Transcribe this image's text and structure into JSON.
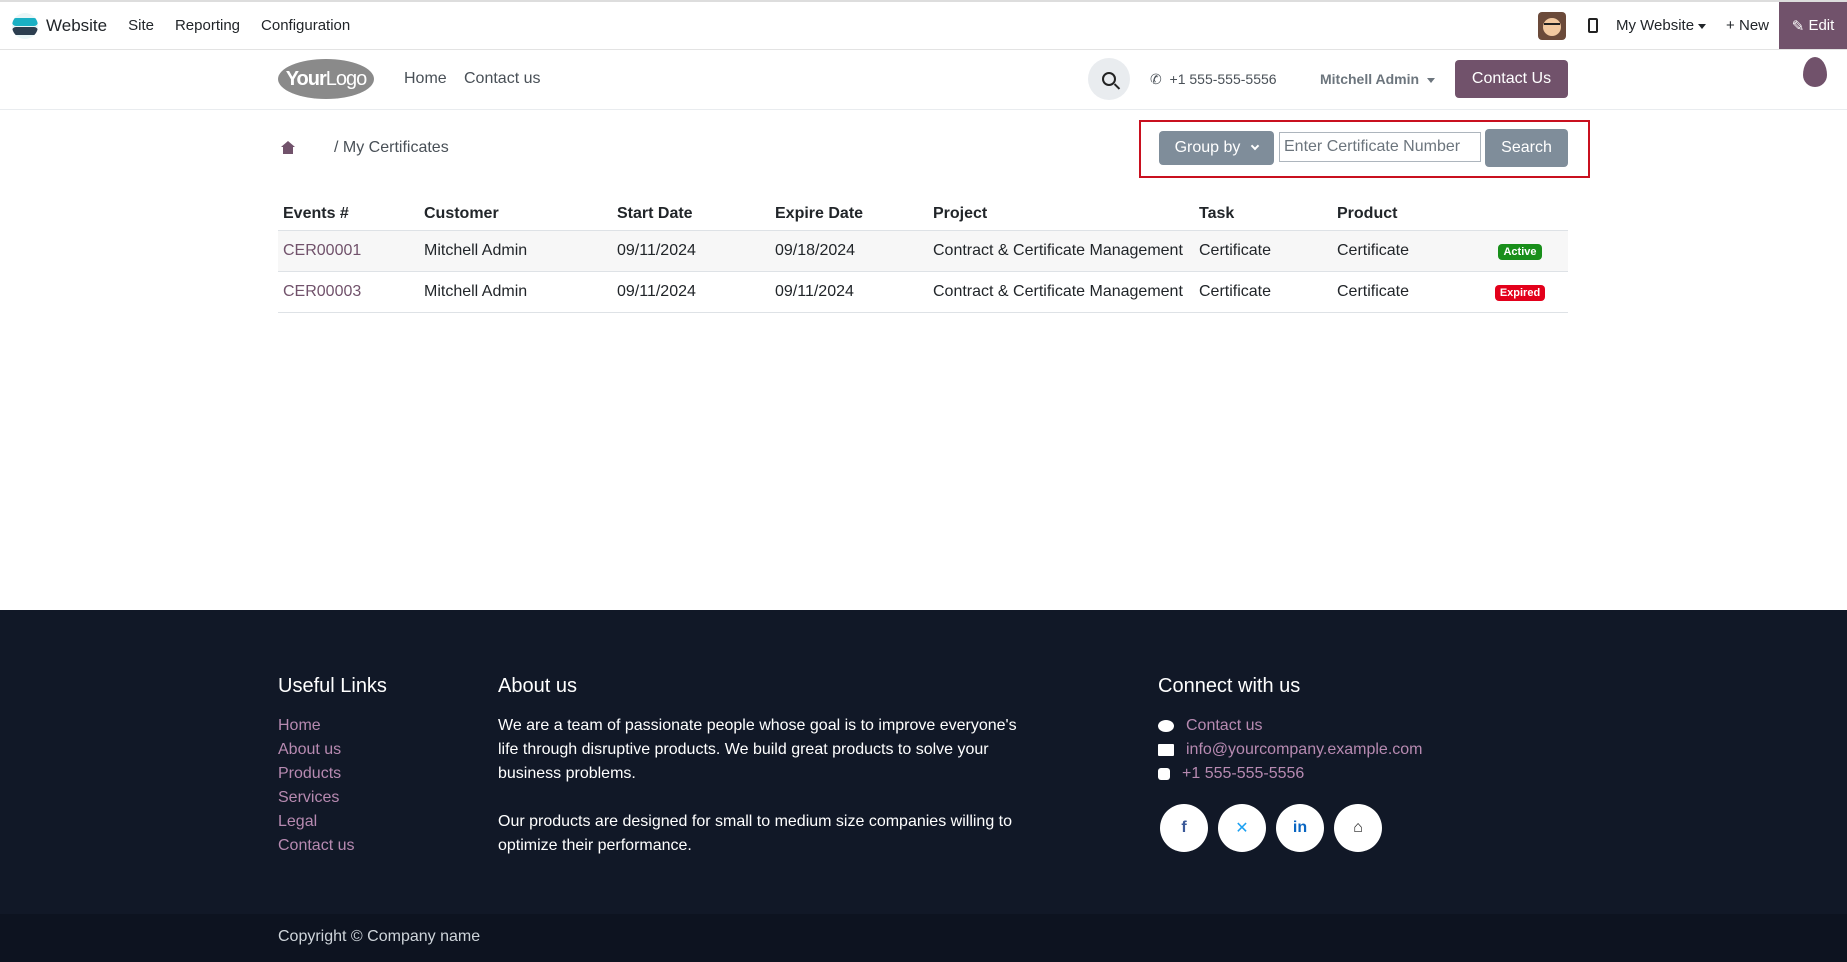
{
  "adminbar": {
    "app_name": "Website",
    "menus": [
      "Site",
      "Reporting",
      "Configuration"
    ],
    "my_website": "My Website",
    "new_label": "New",
    "edit_label": "Edit"
  },
  "header": {
    "logo_bold": "Your",
    "logo_light": "Logo",
    "nav": [
      "Home",
      "Contact us"
    ],
    "phone": "+1 555-555-5556",
    "user": "Mitchell Admin",
    "contact_button": "Contact Us"
  },
  "breadcrumb": {
    "current": "/ My Certificates"
  },
  "search": {
    "group_by_label": "Group by",
    "placeholder": "Enter Certificate Number",
    "search_label": "Search"
  },
  "table": {
    "columns": [
      "Events #",
      "Customer",
      "Start Date",
      "Expire Date",
      "Project",
      "Task",
      "Product",
      ""
    ],
    "rows": [
      {
        "number": "CER00001",
        "customer": "Mitchell Admin",
        "start": "09/11/2024",
        "expire": "09/18/2024",
        "project": "Contract & Certificate Management",
        "task": "Certificate",
        "product": "Certificate",
        "status": "Active"
      },
      {
        "number": "CER00003",
        "customer": "Mitchell Admin",
        "start": "09/11/2024",
        "expire": "09/11/2024",
        "project": "Contract & Certificate Management",
        "task": "Certificate",
        "product": "Certificate",
        "status": "Expired"
      }
    ]
  },
  "footer": {
    "useful_links_title": "Useful Links",
    "useful_links": [
      "Home",
      "About us",
      "Products",
      "Services",
      "Legal",
      "Contact us"
    ],
    "about_title": "About us",
    "about_p1": "We are a team of passionate people whose goal is to improve everyone's life through disruptive products. We build great products to solve your business problems.",
    "about_p2": "Our products are designed for small to medium size companies willing to optimize their performance.",
    "connect_title": "Connect with us",
    "connect_contact": "Contact us",
    "connect_email": "info@yourcompany.example.com",
    "connect_phone": "+1 555-555-5556",
    "social_icons": [
      "facebook-icon",
      "x-icon",
      "linkedin-icon",
      "home-icon"
    ],
    "copyright": "Copyright © Company name"
  },
  "colors": {
    "brand": "#71526b",
    "active_badge": "#198f1b",
    "expired_badge": "#e3001b",
    "footer_bg": "#111827",
    "highlight_box": "#c9101f"
  }
}
